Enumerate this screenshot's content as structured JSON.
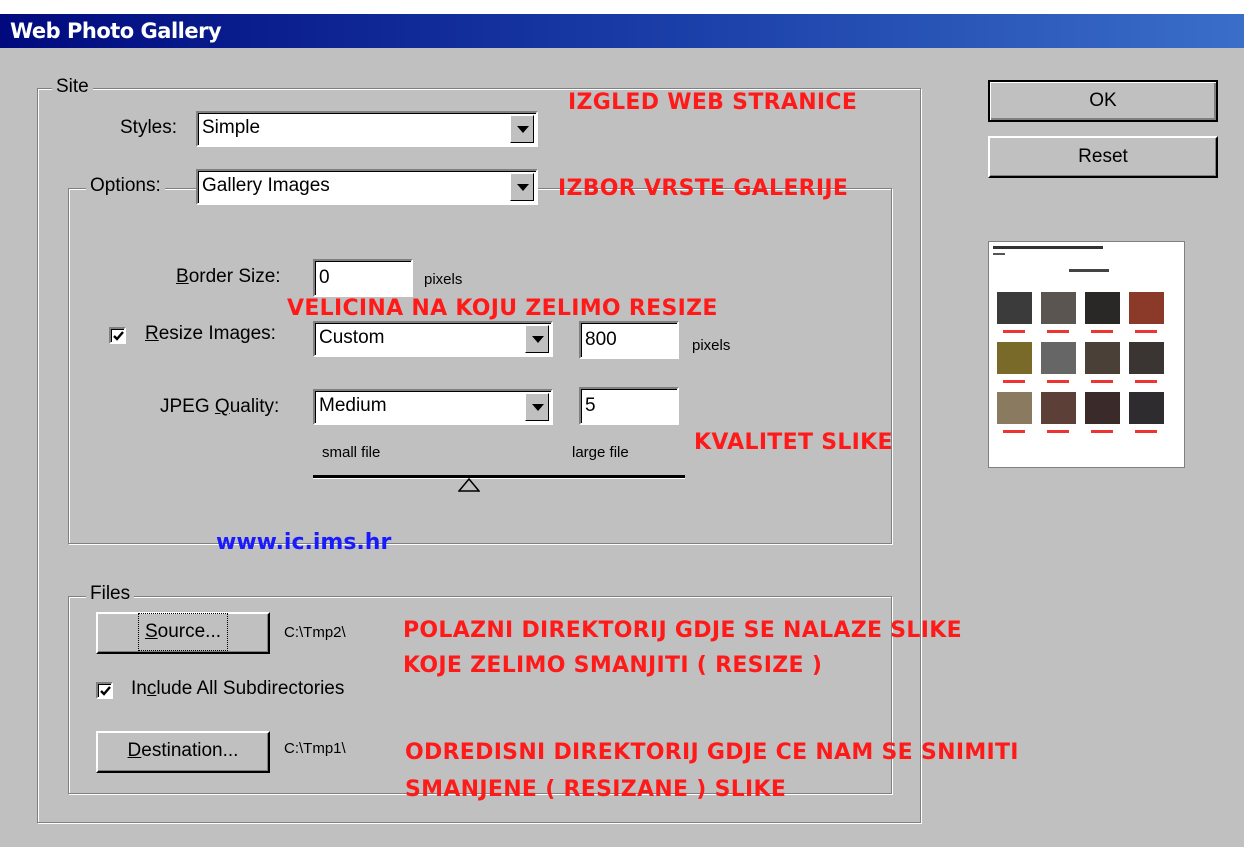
{
  "window": {
    "title": "Web Photo Gallery"
  },
  "site": {
    "legend": "Site",
    "styles_label": "Styles:",
    "styles_value": "Simple",
    "options_label": "Options:",
    "options_value": "Gallery Images",
    "border_size_label": "Border Size:",
    "border_size_value": "0",
    "border_size_unit": "pixels",
    "resize_label": "Resize Images:",
    "resize_checked": true,
    "resize_mode": "Custom",
    "resize_value": "800",
    "resize_unit": "pixels",
    "jpeg_label": "JPEG Quality:",
    "jpeg_mode": "Medium",
    "jpeg_value": "5",
    "slider_min_label": "small file",
    "slider_max_label": "large file",
    "slider_value_fraction": 0.42
  },
  "files": {
    "legend": "Files",
    "source_button": "Source...",
    "source_path": "C:\\Tmp2\\",
    "include_subdirs_label": "Include All Subdirectories",
    "include_subdirs_checked": true,
    "destination_button": "Destination...",
    "destination_path": "C:\\Tmp1\\"
  },
  "buttons": {
    "ok": "OK",
    "reset": "Reset"
  },
  "annotations": {
    "styles_note": "IZGLED WEB STRANICE",
    "options_note": "IZBOR VRSTE GALERIJE",
    "resize_note": "VELICINA NA KOJU ZELIMO RESIZE",
    "quality_note": "KVALITET SLIKE",
    "website": "www.ic.ims.hr",
    "source_note_1": "POLAZNI DIREKTORIJ GDJE SE NALAZE SLIKE",
    "source_note_2": "KOJE ZELIMO SMANJITI ( RESIZE )",
    "dest_note_1": "ODREDISNI DIREKTORIJ GDJE CE NAM SE SNIMITI",
    "dest_note_2": "SMANJENE ( RESIZANE ) SLIKE"
  },
  "colors": {
    "annotation": "#ff1a1a",
    "link": "#1a1aff",
    "titlebar": "#000a7e",
    "face": "#c0c0c0"
  }
}
